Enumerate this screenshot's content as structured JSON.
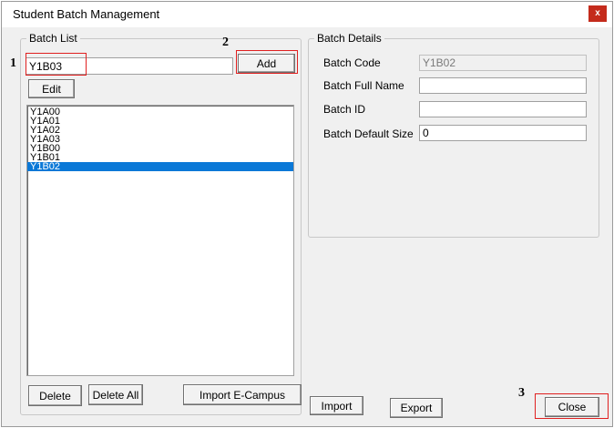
{
  "window": {
    "title": "Student Batch Management",
    "close_glyph": "x"
  },
  "batch_list": {
    "legend": "Batch List",
    "new_batch_value": "Y1B03",
    "add_label": "Add",
    "edit_label": "Edit",
    "items": [
      "Y1A00",
      "Y1A01",
      "Y1A02",
      "Y1A03",
      "Y1B00",
      "Y1B01",
      "Y1B02"
    ],
    "selected_index": 6,
    "delete_label": "Delete",
    "delete_all_label": "Delete All",
    "import_ecampus_label": "Import E-Campus"
  },
  "batch_details": {
    "legend": "Batch Details",
    "code_label": "Batch Code",
    "code_value": "Y1B02",
    "full_name_label": "Batch Full Name",
    "full_name_value": "",
    "id_label": "Batch ID",
    "id_value": "",
    "default_size_label": "Batch Default Size",
    "default_size_value": "0"
  },
  "footer": {
    "import_label": "Import",
    "export_label": "Export",
    "close_label": "Close"
  },
  "annotations": {
    "marker_1": "1",
    "marker_2": "2",
    "marker_3": "3"
  },
  "colors": {
    "selection": "#0a78d7",
    "annotation_box": "#e02020",
    "close_glyph_bg": "#c42b1c"
  }
}
